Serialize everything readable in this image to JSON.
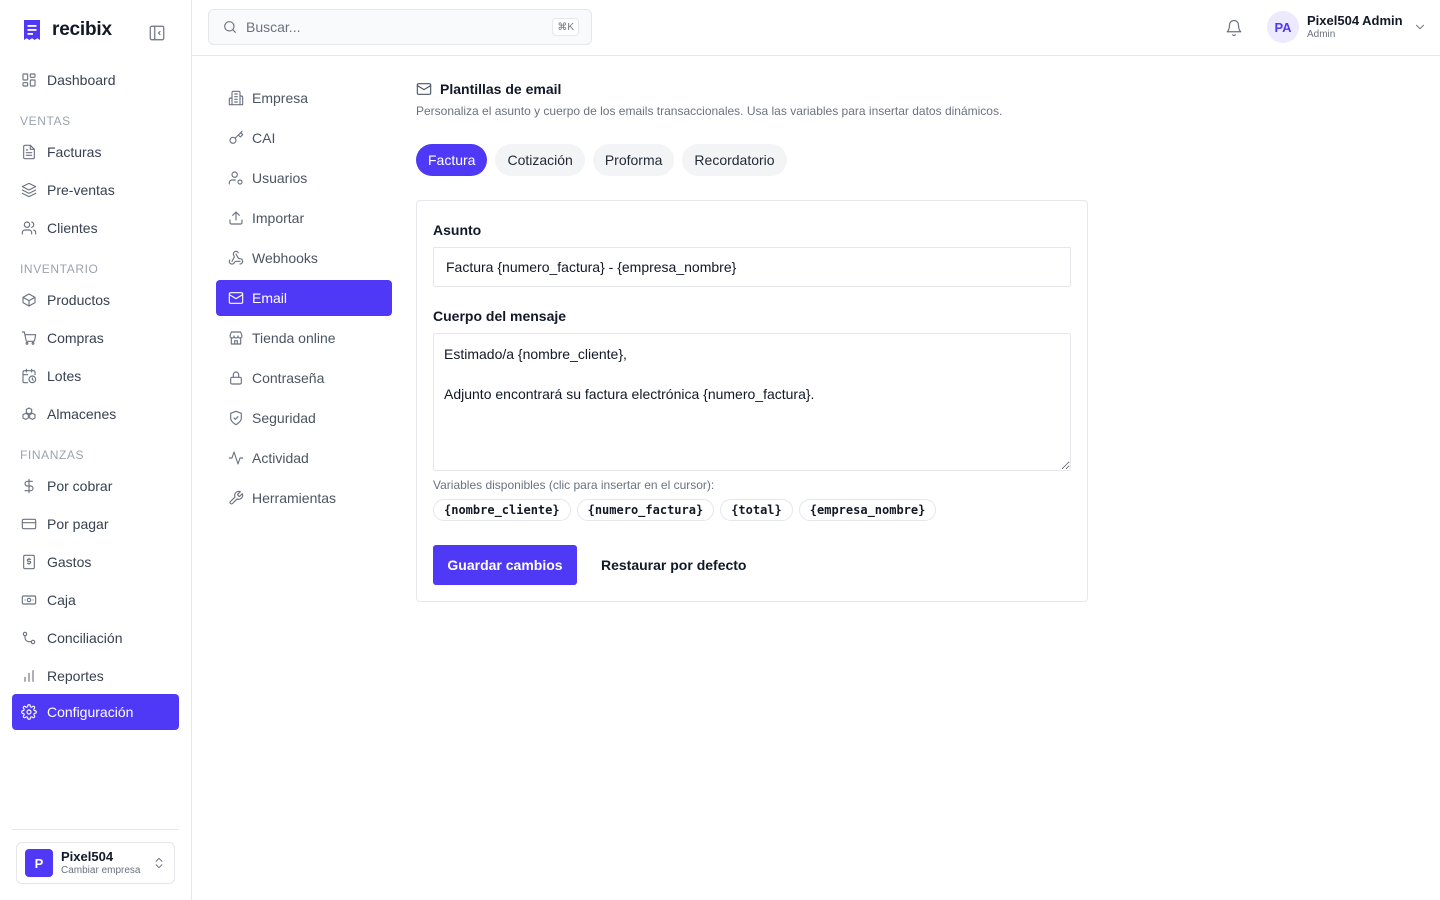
{
  "app": {
    "name": "recibix"
  },
  "sidebar": {
    "items": [
      {
        "label": "Dashboard",
        "icon": "dashboard-icon"
      },
      {
        "label": "Facturas",
        "icon": "invoice-icon"
      },
      {
        "label": "Pre-ventas",
        "icon": "layers-icon"
      },
      {
        "label": "Clientes",
        "icon": "users-icon"
      },
      {
        "label": "Productos",
        "icon": "package-icon"
      },
      {
        "label": "Compras",
        "icon": "cart-icon"
      },
      {
        "label": "Lotes",
        "icon": "calendar-clock-icon"
      },
      {
        "label": "Almacenes",
        "icon": "boxes-icon"
      },
      {
        "label": "Por cobrar",
        "icon": "dollar-icon"
      },
      {
        "label": "Por pagar",
        "icon": "credit-card-icon"
      },
      {
        "label": "Gastos",
        "icon": "receipt-icon"
      },
      {
        "label": "Caja",
        "icon": "banknote-icon"
      },
      {
        "label": "Conciliación",
        "icon": "git-compare-icon"
      },
      {
        "label": "Reportes",
        "icon": "bar-chart-icon"
      },
      {
        "label": "Configuración",
        "icon": "gear-icon"
      }
    ],
    "sections": [
      "VENTAS",
      "INVENTARIO",
      "FINANZAS"
    ],
    "company": {
      "initial": "P",
      "name": "Pixel504",
      "subtitle": "Cambiar empresa"
    }
  },
  "header": {
    "search_placeholder": "Buscar...",
    "shortcut": "⌘K",
    "user": {
      "initials": "PA",
      "name": "Pixel504 Admin",
      "role": "Admin"
    }
  },
  "settings_nav": [
    {
      "label": "Empresa",
      "icon": "building-icon"
    },
    {
      "label": "CAI",
      "icon": "key-icon"
    },
    {
      "label": "Usuarios",
      "icon": "user-cog-icon"
    },
    {
      "label": "Importar",
      "icon": "upload-icon"
    },
    {
      "label": "Webhooks",
      "icon": "webhook-icon"
    },
    {
      "label": "Email",
      "icon": "mail-icon"
    },
    {
      "label": "Tienda online",
      "icon": "store-icon"
    },
    {
      "label": "Contraseña",
      "icon": "lock-icon"
    },
    {
      "label": "Seguridad",
      "icon": "shield-icon"
    },
    {
      "label": "Actividad",
      "icon": "activity-icon"
    },
    {
      "label": "Herramientas",
      "icon": "wrench-icon"
    }
  ],
  "email_templates": {
    "title": "Plantillas de email",
    "description": "Personaliza el asunto y cuerpo de los emails transaccionales. Usa las variables para insertar datos dinámicos.",
    "tabs": [
      "Factura",
      "Cotización",
      "Proforma",
      "Recordatorio"
    ],
    "active_tab": "Factura",
    "subject_label": "Asunto",
    "subject_value": "Factura {numero_factura} - {empresa_nombre}",
    "body_label": "Cuerpo del mensaje",
    "body_value": "Estimado/a {nombre_cliente},\n\nAdjunto encontrará su factura electrónica {numero_factura}.",
    "vars_hint": "Variables disponibles (clic para insertar en el cursor):",
    "variables": [
      "{nombre_cliente}",
      "{numero_factura}",
      "{total}",
      "{empresa_nombre}"
    ],
    "save_label": "Guardar cambios",
    "reset_label": "Restaurar por defecto"
  },
  "colors": {
    "accent": "#4f39f6",
    "border": "#e5e7eb",
    "muted": "#6b7280"
  }
}
